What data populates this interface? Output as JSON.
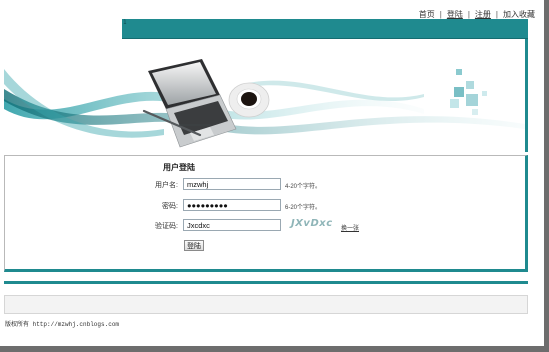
{
  "top_nav": {
    "home": "首页",
    "login": "登陆",
    "register": "注册",
    "favorite": "加入收藏",
    "separator": "|"
  },
  "strip_mark": "1",
  "login": {
    "title": "用户登陆",
    "username_label": "用户名:",
    "username_value": "mzwhj",
    "username_hint": "4-20个字符。",
    "password_label": "密码:",
    "password_value": "●●●●●●●●●",
    "password_hint": "6-20个字符。",
    "captcha_label": "验证码:",
    "captcha_value": "Jxcdxc",
    "captcha_image_text": "JXvDxc",
    "refresh_link": "换一张",
    "submit_label": "登陆"
  },
  "footer": {
    "copyright": "版权所有 http://mzwhj.cnblogs.com"
  },
  "colors": {
    "accent_teal": "#1f8a8f",
    "frame_gray": "#6d6d6d"
  }
}
